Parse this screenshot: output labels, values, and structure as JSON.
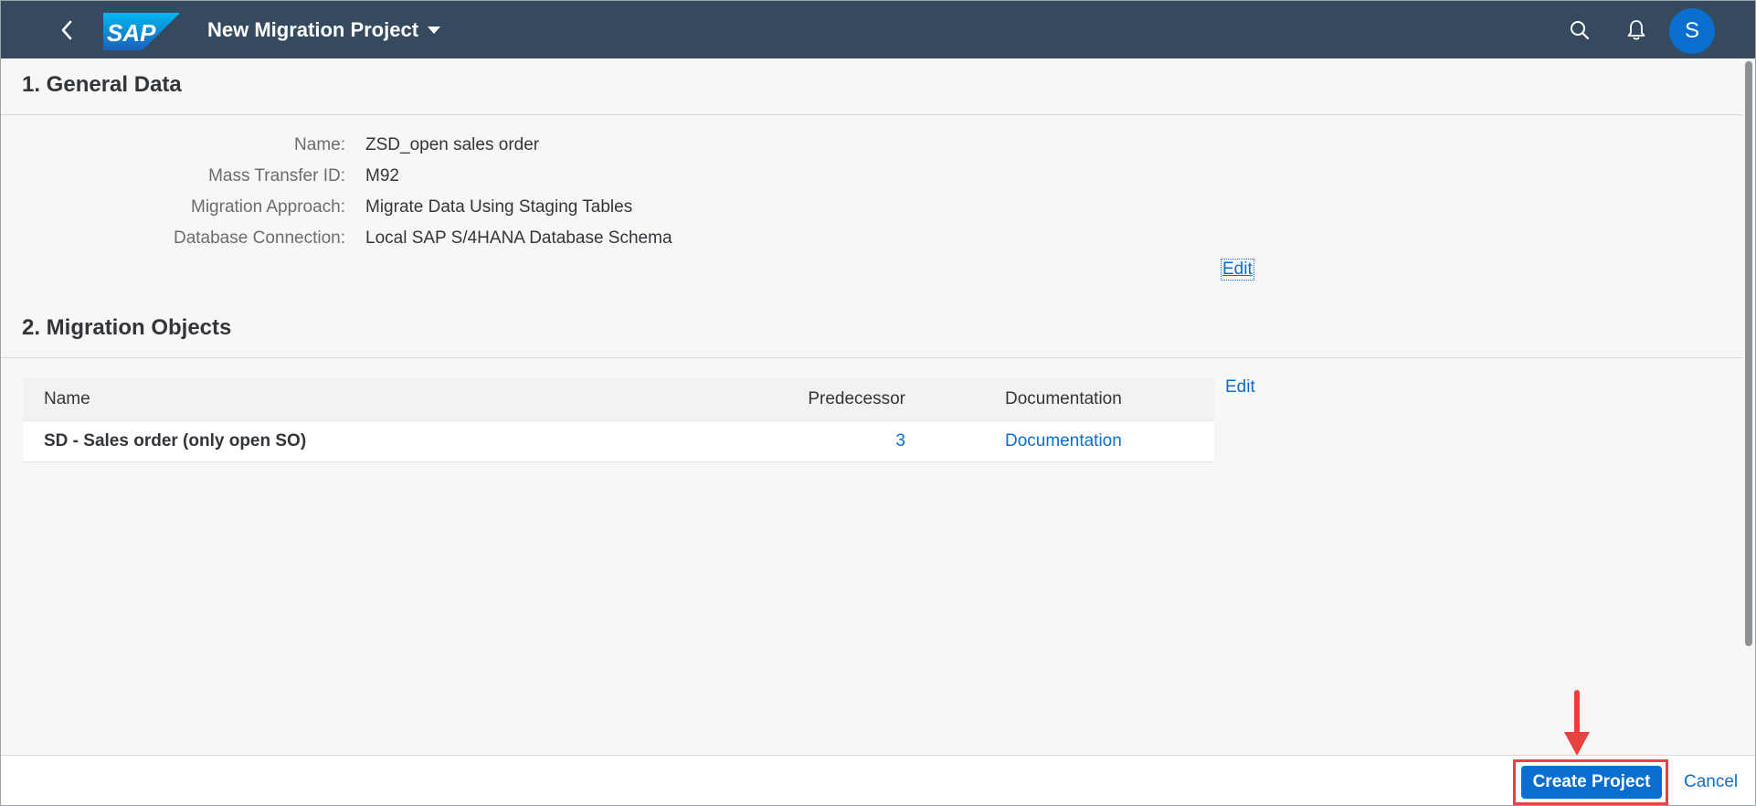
{
  "shell": {
    "logo_text": "SAP",
    "title": "New Migration Project",
    "avatar_initial": "S",
    "icons": [
      "back-icon",
      "search-icon",
      "bell-icon",
      "chevron-down-icon"
    ]
  },
  "general_data": {
    "title": "1. General Data",
    "fields": [
      {
        "label": "Name:",
        "value": "ZSD_open sales order"
      },
      {
        "label": "Mass Transfer ID:",
        "value": "M92"
      },
      {
        "label": "Migration Approach:",
        "value": "Migrate Data Using Staging Tables"
      },
      {
        "label": "Database Connection:",
        "value": "Local SAP S/4HANA Database Schema"
      }
    ],
    "edit_label": "Edit"
  },
  "migration_objects": {
    "title": "2. Migration Objects",
    "edit_label": "Edit",
    "columns": {
      "name": "Name",
      "predecessor": "Predecessor",
      "documentation": "Documentation"
    },
    "rows": [
      {
        "name": "SD - Sales order (only open SO)",
        "predecessor": "3",
        "documentation": "Documentation"
      }
    ]
  },
  "footer": {
    "create_label": "Create Project",
    "cancel_label": "Cancel"
  },
  "colors": {
    "shell_bg": "#354a5f",
    "accent": "#0a6ed1",
    "annotation": "#e8423f"
  }
}
